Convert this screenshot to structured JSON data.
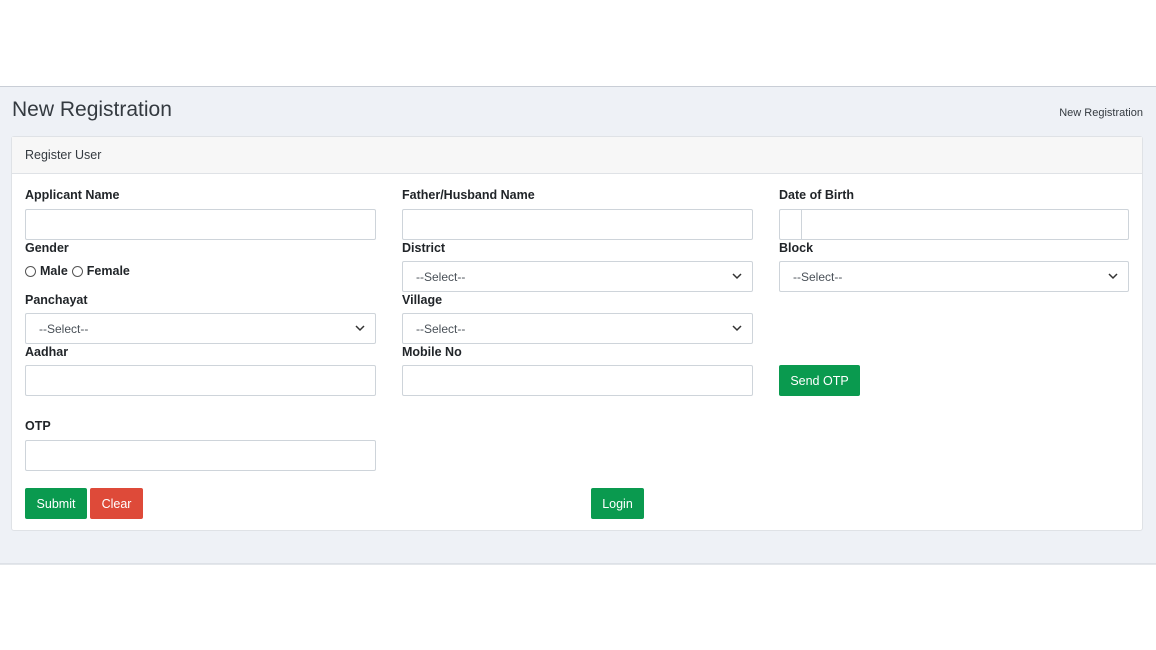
{
  "header": {
    "page_title": "New Registration",
    "breadcrumb": "New Registration"
  },
  "card": {
    "title": "Register User"
  },
  "form": {
    "applicant_name": {
      "label": "Applicant Name",
      "value": ""
    },
    "father_husband_name": {
      "label": "Father/Husband Name",
      "value": ""
    },
    "date_of_birth": {
      "label": "Date of Birth",
      "value": ""
    },
    "gender": {
      "label": "Gender",
      "options": [
        "Male",
        "Female"
      ]
    },
    "district": {
      "label": "District",
      "selected": "--Select--"
    },
    "block": {
      "label": "Block",
      "selected": "--Select--"
    },
    "panchayat": {
      "label": "Panchayat",
      "selected": "--Select--"
    },
    "village": {
      "label": "Village",
      "selected": "--Select--"
    },
    "aadhar": {
      "label": "Aadhar",
      "value": ""
    },
    "mobile_no": {
      "label": "Mobile No",
      "value": ""
    },
    "otp": {
      "label": "OTP",
      "value": ""
    }
  },
  "buttons": {
    "send_otp": "Send OTP",
    "submit": "Submit",
    "clear": "Clear",
    "login": "Login"
  },
  "icons": {
    "select_arrow": "chevron-down-icon",
    "radio": "radio-empty-icon"
  },
  "colors": {
    "primary_green": "#0a9a4f",
    "danger_red": "#de4a39",
    "band_background": "#eef1f6"
  }
}
